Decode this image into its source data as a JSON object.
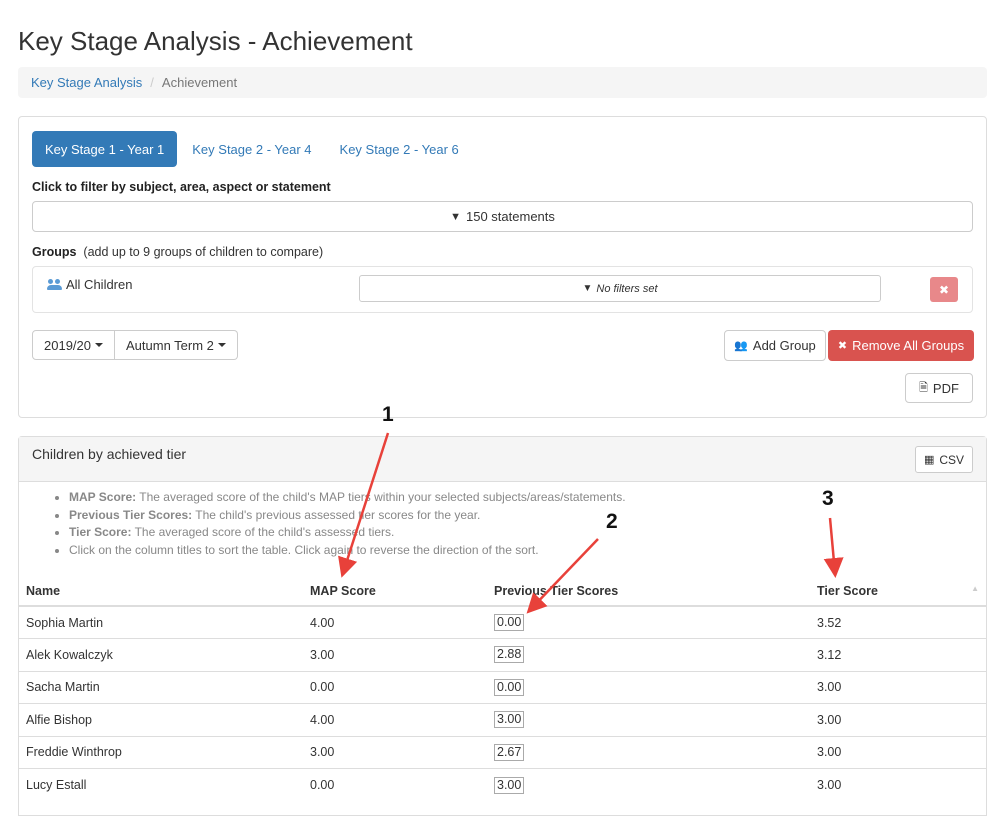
{
  "page": {
    "title": "Key Stage Analysis - Achievement"
  },
  "breadcrumb": {
    "parent": "Key Stage Analysis",
    "separator": "/",
    "current": "Achievement"
  },
  "tabs": [
    {
      "label": "Key Stage 1 - Year 1",
      "active": true
    },
    {
      "label": "Key Stage 2 - Year 4",
      "active": false
    },
    {
      "label": "Key Stage 2 - Year 6",
      "active": false
    }
  ],
  "filters": {
    "label": "Click to filter by subject, area, aspect or statement",
    "statements_button": "150 statements",
    "filter_icon": "filter-icon"
  },
  "groups": {
    "label_bold": "Groups",
    "label_note": "(add up to 9 groups of children to compare)",
    "row": {
      "name": "All Children",
      "icon": "users-icon",
      "filter_text": "No filters set",
      "remove_icon": "close-icon"
    }
  },
  "selectors": {
    "year": "2019/20",
    "term": "Autumn Term 2"
  },
  "buttons": {
    "add_group": "Add Group",
    "remove_all_groups": "Remove All Groups",
    "pdf": "PDF",
    "csv": "CSV"
  },
  "achieved_panel": {
    "title": "Children by achieved tier",
    "legend": [
      {
        "term": "MAP Score:",
        "text": " The averaged score of the child's MAP tiers within your selected subjects/areas/statements."
      },
      {
        "term": "Previous Tier Scores:",
        "text": " The child's previous assessed tier scores for the year."
      },
      {
        "term": "Tier Score:",
        "text": " The averaged score of the child's assessed tiers."
      },
      {
        "term": "",
        "text": "Click on the column titles to sort the table. Click again to reverse the direction of the sort."
      }
    ]
  },
  "table": {
    "columns": [
      "Name",
      "MAP Score",
      "Previous Tier Scores",
      "Tier Score"
    ],
    "rows": [
      {
        "name": "Sophia Martin",
        "map": "4.00",
        "prev": "0.00",
        "tier": "3.52"
      },
      {
        "name": "Alek Kowalczyk",
        "map": "3.00",
        "prev": "2.88",
        "tier": "3.12"
      },
      {
        "name": "Sacha Martin",
        "map": "0.00",
        "prev": "0.00",
        "tier": "3.00"
      },
      {
        "name": "Alfie Bishop",
        "map": "4.00",
        "prev": "3.00",
        "tier": "3.00"
      },
      {
        "name": "Freddie Winthrop",
        "map": "3.00",
        "prev": "2.67",
        "tier": "3.00"
      },
      {
        "name": "Lucy Estall",
        "map": "0.00",
        "prev": "3.00",
        "tier": "3.00"
      }
    ]
  },
  "annotations": {
    "one": "1",
    "two": "2",
    "three": "3",
    "arrow_color": "#e8413a"
  }
}
